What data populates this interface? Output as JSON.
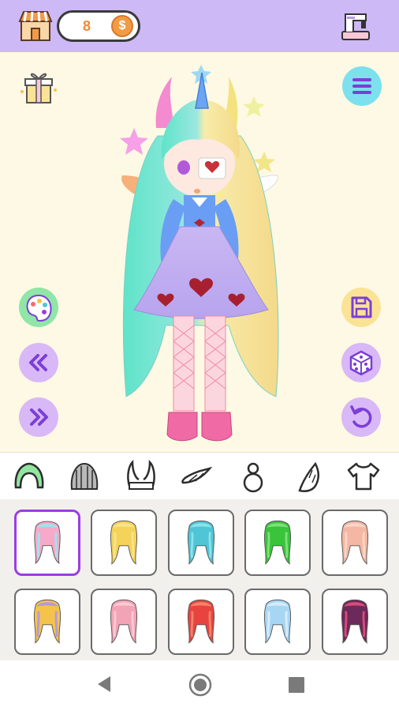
{
  "header": {
    "coin_count": "8",
    "coin_symbol": "$",
    "shop_icon": "shop-icon",
    "sewing_icon": "sewing-machine-icon"
  },
  "stage_buttons": {
    "gift": "gift-box-icon",
    "menu": "hamburger-menu-icon",
    "palette": "palette-icon",
    "prev": "double-chevron-left-icon",
    "next": "double-chevron-right-icon",
    "save": "floppy-disk-icon",
    "random": "dice-icon",
    "undo": "undo-icon"
  },
  "categories": [
    {
      "id": "hair",
      "icon": "hair-icon",
      "active": true
    },
    {
      "id": "hat",
      "icon": "beanie-icon",
      "active": false
    },
    {
      "id": "horns",
      "icon": "horns-icon",
      "active": false
    },
    {
      "id": "wings",
      "icon": "wing-icon",
      "active": false
    },
    {
      "id": "body",
      "icon": "body-icon",
      "active": false
    },
    {
      "id": "tail",
      "icon": "tail-icon",
      "active": false
    },
    {
      "id": "top",
      "icon": "shirt-icon",
      "active": false
    }
  ],
  "items": [
    {
      "kind": "hair",
      "colors": [
        "#f6a9c8",
        "#9fe3f0"
      ],
      "selected": true
    },
    {
      "kind": "hair",
      "colors": [
        "#f5d25a",
        "#f9e48a"
      ],
      "selected": false
    },
    {
      "kind": "hair",
      "colors": [
        "#4fc5d6",
        "#8be3ec"
      ],
      "selected": false
    },
    {
      "kind": "hair",
      "colors": [
        "#39c43a",
        "#7fe07a"
      ],
      "selected": false
    },
    {
      "kind": "hair",
      "colors": [
        "#f3b7a3",
        "#f9d6c7"
      ],
      "selected": false
    },
    {
      "kind": "hair",
      "colors": [
        "#f6c34a",
        "#b39ae0"
      ],
      "selected": false
    },
    {
      "kind": "hair",
      "colors": [
        "#f3a3b6",
        "#f9c9d4"
      ],
      "selected": false
    },
    {
      "kind": "hair",
      "colors": [
        "#e8443f",
        "#f1836a"
      ],
      "selected": false
    },
    {
      "kind": "hair",
      "colors": [
        "#a7d6f3",
        "#d7ebfb"
      ],
      "selected": false
    },
    {
      "kind": "hair",
      "colors": [
        "#6b2a5a",
        "#d94b7a"
      ],
      "selected": false
    }
  ],
  "colors": {
    "topbar": "#cdb9f5",
    "stage_bg": "#fdf9e4",
    "selected_border": "#9b3ce6"
  }
}
